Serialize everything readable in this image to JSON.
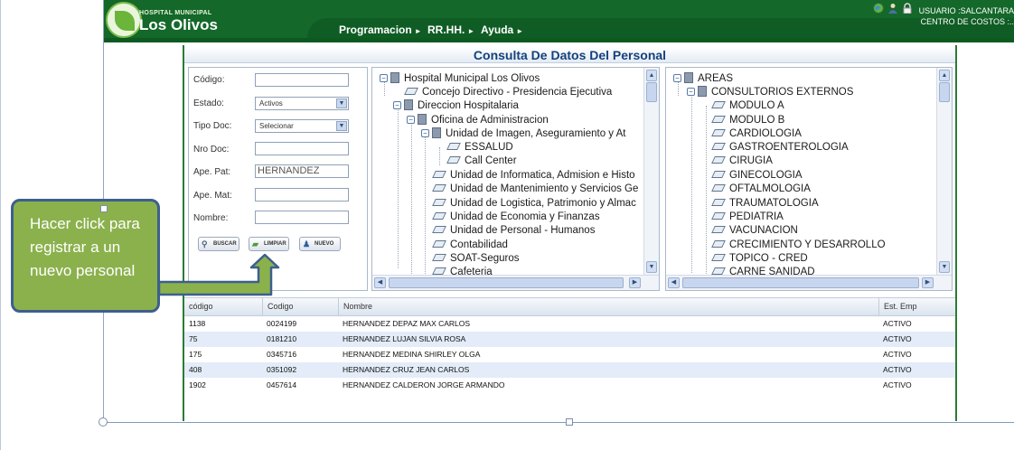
{
  "header": {
    "logo_small": "HOSPITAL MUNICIPAL",
    "logo_big": "Los Olivos",
    "menus": [
      {
        "label": "Programacion"
      },
      {
        "label": "RR.HH."
      },
      {
        "label": "Ayuda"
      }
    ],
    "user_line1": "USUARIO :SALCANTARA",
    "user_line2": "CENTRO DE COSTOS :..",
    "icons": [
      "globe-icon",
      "user-icon",
      "lock-icon"
    ]
  },
  "page": {
    "title": "Consulta De Datos Del Personal"
  },
  "form": {
    "codigo_label": "Código:",
    "codigo_value": "",
    "estado_label": "Estado:",
    "estado_value": "Activos",
    "tipo_doc_label": "Tipo Doc:",
    "tipo_doc_value": "Selecionar",
    "nro_doc_label": "Nro Doc:",
    "nro_doc_value": "",
    "ape_pat_label": "Ape. Pat:",
    "ape_pat_value": "HERNANDEZ",
    "ape_mat_label": "Ape. Mat:",
    "ape_mat_value": "",
    "nombre_label": "Nombre:",
    "nombre_value": "",
    "buscar_label": "BUSCAR",
    "limpiar_label": "LIMPIAR",
    "nuevo_label": "NUEVO"
  },
  "org_tree": {
    "nodes": [
      "Hospital Municipal Los Olivos",
      "Concejo Directivo - Presidencia Ejecutiva",
      "Direccion Hospitalaria",
      "Oficina de Administracion",
      "Unidad de Imagen, Aseguramiento y At",
      "ESSALUD",
      "Call Center",
      "Unidad de Informatica, Admision e Histo",
      "Unidad de Mantenimiento y Servicios Ge",
      "Unidad de Logistica, Patrimonio y Almac",
      "Unidad de Economia y Finanzas",
      "Unidad de Personal - Humanos",
      "Contabilidad",
      "SOAT-Seguros",
      "Cafeteria"
    ]
  },
  "areas_tree": {
    "nodes": [
      "AREAS",
      "CONSULTORIOS EXTERNOS",
      "MODULO A",
      "MODULO B",
      "CARDIOLOGIA",
      "GASTROENTEROLOGIA",
      "CIRUGIA",
      "GINECOLOGIA",
      "OFTALMOLOGIA",
      "TRAUMATOLOGIA",
      "PEDIATRIA",
      "VACUNACION",
      "CRECIMIENTO Y DESARROLLO",
      "TOPICO - CRED",
      "CARNE SANIDAD"
    ]
  },
  "grid": {
    "headers": [
      "código",
      "Codigo",
      "Nombre",
      "Est. Emp"
    ],
    "rows": [
      [
        "1138",
        "0024199",
        "HERNANDEZ DEPAZ MAX CARLOS",
        "ACTIVO"
      ],
      [
        "75",
        "0181210",
        "HERNANDEZ LUJAN SILVIA ROSA",
        "ACTIVO"
      ],
      [
        "175",
        "0345716",
        "HERNANDEZ MEDINA SHIRLEY OLGA",
        "ACTIVO"
      ],
      [
        "408",
        "0351092",
        "HERNANDEZ CRUZ JEAN CARLOS",
        "ACTIVO"
      ],
      [
        "1902",
        "0457614",
        "HERNANDEZ CALDERON JORGE ARMANDO",
        "ACTIVO"
      ]
    ]
  },
  "callout": {
    "text": "Hacer click para registrar a un nuevo personal"
  },
  "colors": {
    "header_green": "#14682a",
    "title_blue": "#13417c",
    "callout_green": "#8bb14d",
    "callout_border": "#3d5f8d",
    "row_alt": "#e3ecf8"
  }
}
